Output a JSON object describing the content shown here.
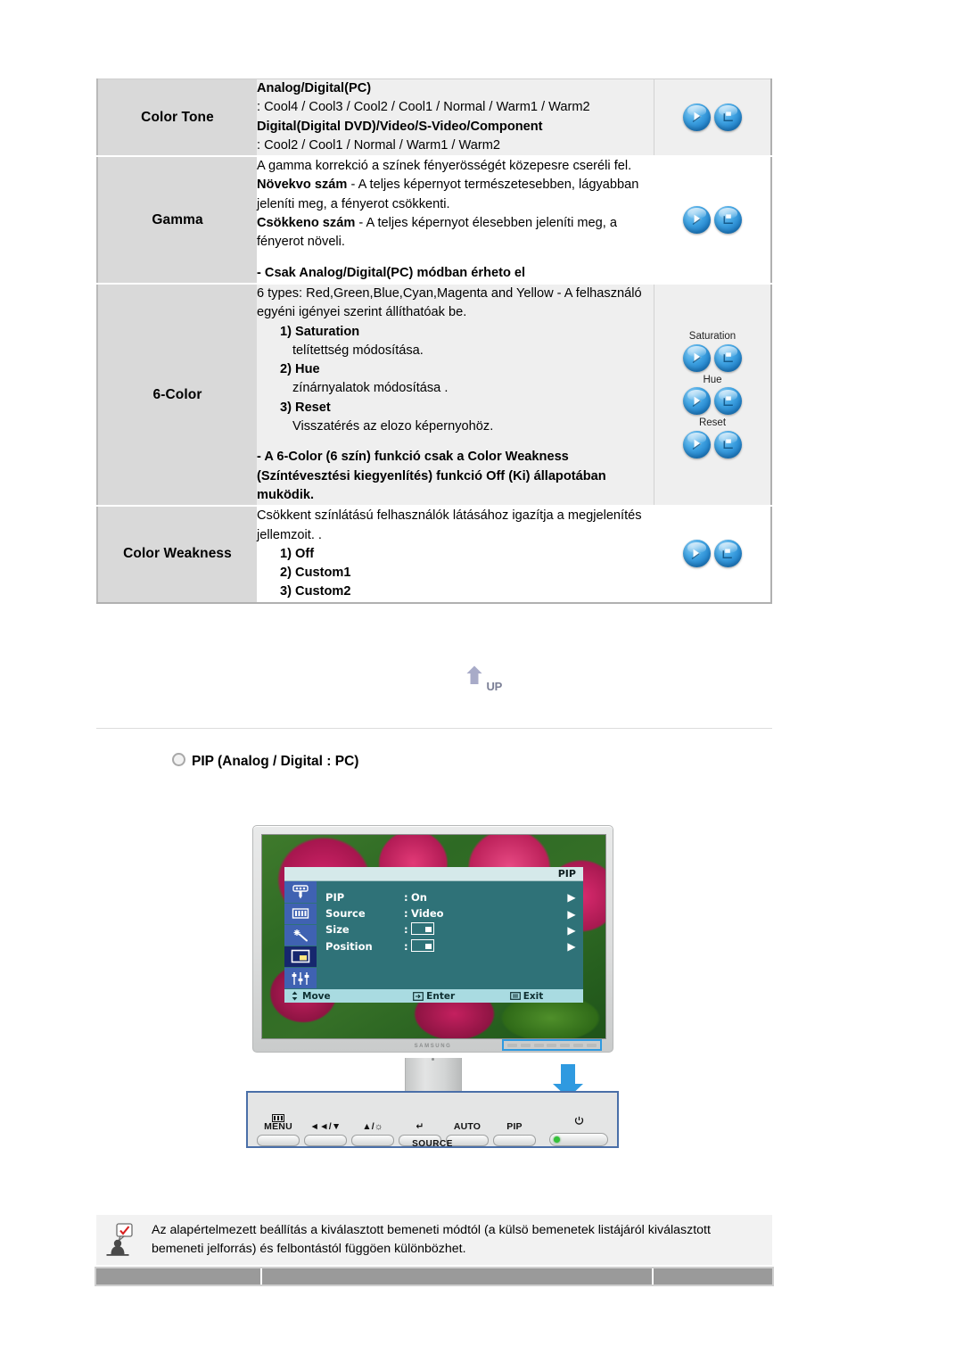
{
  "table": {
    "rows": [
      {
        "name": "Color Tone",
        "lines": [
          {
            "text": "Analog/Digital(PC)",
            "style": "bold"
          },
          {
            "text": ": Cool4 / Cool3 / Cool2 / Cool1 / Normal / Warm1 / Warm2",
            "style": "normal"
          },
          {
            "text": "Digital(Digital DVD)/Video/S-Video/Component",
            "style": "bold"
          },
          {
            "text": ": Cool2 / Cool1 / Normal / Warm1 / Warm2",
            "style": "normal"
          }
        ],
        "icons": [
          {
            "label": "",
            "buttons": [
              "play-icon",
              "enter-icon"
            ]
          }
        ]
      },
      {
        "name": "Gamma",
        "lines": [
          {
            "text": "A gamma korrekció a színek fényerösségét közepesre cseréli fel.",
            "style": "normal"
          },
          {
            "text": "Növekvo szám - A teljes képernyot természetesebben, lágyabban jeleníti meg, a fényerot csökkenti.",
            "style": "lead-bold",
            "lead": "Növekvo szám"
          },
          {
            "text": "Csökkeno szám - A teljes képernyot élesebben jeleníti meg, a fényerot növeli.",
            "style": "lead-bold",
            "lead": "Csökkeno szám"
          },
          {
            "text": "",
            "style": "gap"
          },
          {
            "text": "- Csak Analog/Digital(PC) módban érheto el",
            "style": "bold"
          }
        ],
        "icons": [
          {
            "label": "",
            "buttons": [
              "play-icon",
              "enter-icon"
            ]
          }
        ]
      },
      {
        "name": "6-Color",
        "lines": [
          {
            "text": "6 types: Red,Green,Blue,Cyan,Magenta and Yellow - A felhasználó egyéni igényei szerint állíthatóak be.",
            "style": "normal"
          },
          {
            "text": "1) Saturation",
            "style": "indent-bold"
          },
          {
            "text": "telítettség módosítása.",
            "style": "indent2"
          },
          {
            "text": "2) Hue",
            "style": "indent-bold"
          },
          {
            "text": "zínárnyalatok módosítása .",
            "style": "indent2"
          },
          {
            "text": "3) Reset",
            "style": "indent-bold"
          },
          {
            "text": "Visszatérés az elozo képernyohöz.",
            "style": "indent2"
          },
          {
            "text": "",
            "style": "gap"
          },
          {
            "text": "- A 6-Color (6 szín) funkció csak a Color Weakness (Színtévesztési kiegyenlítés) funkció Off (Ki) állapotában muködik.",
            "style": "bold"
          }
        ],
        "icons": [
          {
            "label": "Saturation",
            "buttons": [
              "play-icon",
              "enter-icon"
            ]
          },
          {
            "label": "Hue",
            "buttons": [
              "play-icon",
              "enter-icon"
            ]
          },
          {
            "label": "Reset",
            "buttons": [
              "play-icon",
              "enter-icon"
            ]
          }
        ]
      },
      {
        "name": "Color Weakness",
        "lines": [
          {
            "text": "Csökkent színlátású felhasználók látásához igazítja a megjelenítés jellemzoit. .",
            "style": "normal"
          },
          {
            "text": "1) Off",
            "style": "indent-bold"
          },
          {
            "text": "2) Custom1",
            "style": "indent-bold"
          },
          {
            "text": "3) Custom2",
            "style": "indent-bold"
          }
        ],
        "icons": [
          {
            "label": "",
            "buttons": [
              "play-icon",
              "enter-icon"
            ]
          }
        ]
      }
    ]
  },
  "up_button": {
    "label": "UP",
    "icon": "up-arrow-icon"
  },
  "section": {
    "heading": "PIP (Analog / Digital : PC)",
    "bullet_icon": "circle-bullet-icon"
  },
  "monitor": {
    "brand": "SAMSUNG",
    "osd": {
      "title": "PIP",
      "sidebar_icons": [
        "brightness-contrast-icon",
        "color-bars-icon",
        "magic-wand-icon",
        "pip-icon",
        "setup-sliders-icon"
      ],
      "selected_sidebar_index": 3,
      "items": [
        {
          "label": "PIP",
          "sep": ":",
          "value": "On",
          "value_type": "text",
          "arrow": "▶"
        },
        {
          "label": "Source",
          "sep": ":",
          "value": "Video",
          "value_type": "text",
          "arrow": "▶"
        },
        {
          "label": "Size",
          "sep": ":",
          "value": "",
          "value_type": "box",
          "arrow": "▶"
        },
        {
          "label": "Position",
          "sep": ":",
          "value": "",
          "value_type": "box",
          "arrow": "▶"
        }
      ],
      "footer": [
        {
          "icon": "move-icon",
          "label": "Move"
        },
        {
          "icon": "enter-key-icon",
          "label": "Enter"
        },
        {
          "icon": "menu-key-icon",
          "label": "Exit"
        }
      ]
    },
    "accent_color": "#2f9ae0"
  },
  "control_panel": {
    "buttons": [
      {
        "caption": "MENU",
        "icon": "menu-bars-icon"
      },
      {
        "caption": "◄◄/▼",
        "icon": ""
      },
      {
        "caption": "▲/☼",
        "icon": ""
      },
      {
        "caption": "↵",
        "icon": "source-enter-icon"
      },
      {
        "caption": "AUTO",
        "icon": ""
      },
      {
        "caption": "PIP",
        "icon": ""
      }
    ],
    "source_label": "SOURCE",
    "power_icon": "power-icon",
    "led_color": "#35c13a"
  },
  "note": {
    "icon": "tip-person-icon",
    "text": "Az alapértelmezett beállítás a kiválasztott bemeneti módtól (a külsö bemenetek listájáról kiválasztott bemeneti jelforrás) és felbontástól függöen különbözhet."
  }
}
